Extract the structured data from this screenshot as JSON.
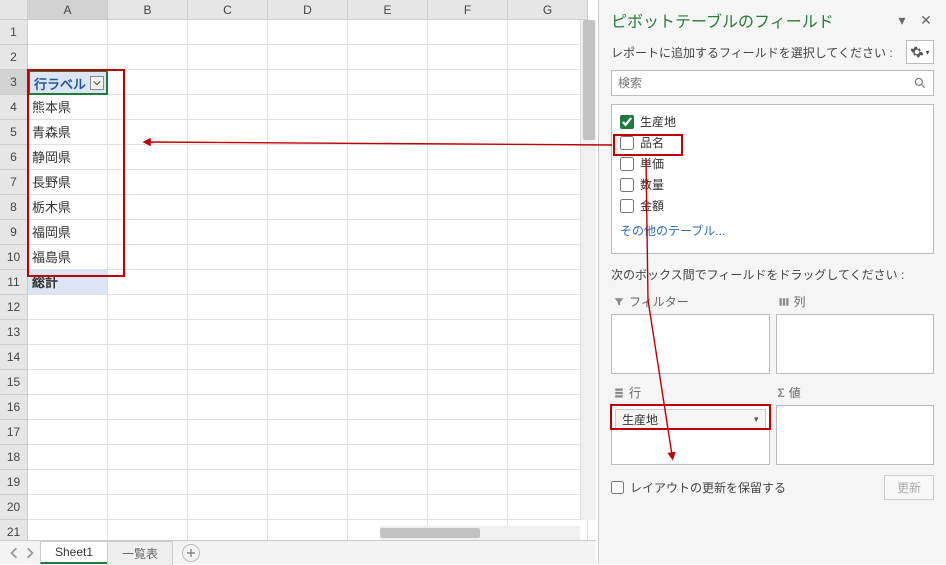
{
  "pane": {
    "title": "ピボットテーブルのフィールド",
    "subtitle": "レポートに追加するフィールドを選択してください :",
    "search_placeholder": "検索",
    "other_tables": "その他のテーブル...",
    "areas_label": "次のボックス間でフィールドをドラッグしてください :",
    "area_filter": "フィルター",
    "area_columns": "列",
    "area_rows": "行",
    "area_values": "値",
    "defer_label": "レイアウトの更新を保留する",
    "update_btn": "更新"
  },
  "fields": [
    {
      "label": "生産地",
      "checked": true
    },
    {
      "label": "品名",
      "checked": false
    },
    {
      "label": "単価",
      "checked": false
    },
    {
      "label": "数量",
      "checked": false
    },
    {
      "label": "金額",
      "checked": false
    }
  ],
  "row_area_field": "生産地",
  "columns": [
    "A",
    "B",
    "C",
    "D",
    "E",
    "F",
    "G"
  ],
  "row_numbers": [
    1,
    2,
    3,
    4,
    5,
    6,
    7,
    8,
    9,
    10,
    11,
    12,
    13,
    14,
    15,
    16,
    17,
    18,
    19,
    20,
    21
  ],
  "active_col": "A",
  "active_row": 3,
  "pivot": {
    "header": "行ラベル",
    "rows": [
      "熊本県",
      "青森県",
      "静岡県",
      "長野県",
      "栃木県",
      "福岡県",
      "福島県"
    ],
    "total": "総計"
  },
  "sheets": {
    "active": "Sheet1",
    "other": "一覧表"
  }
}
